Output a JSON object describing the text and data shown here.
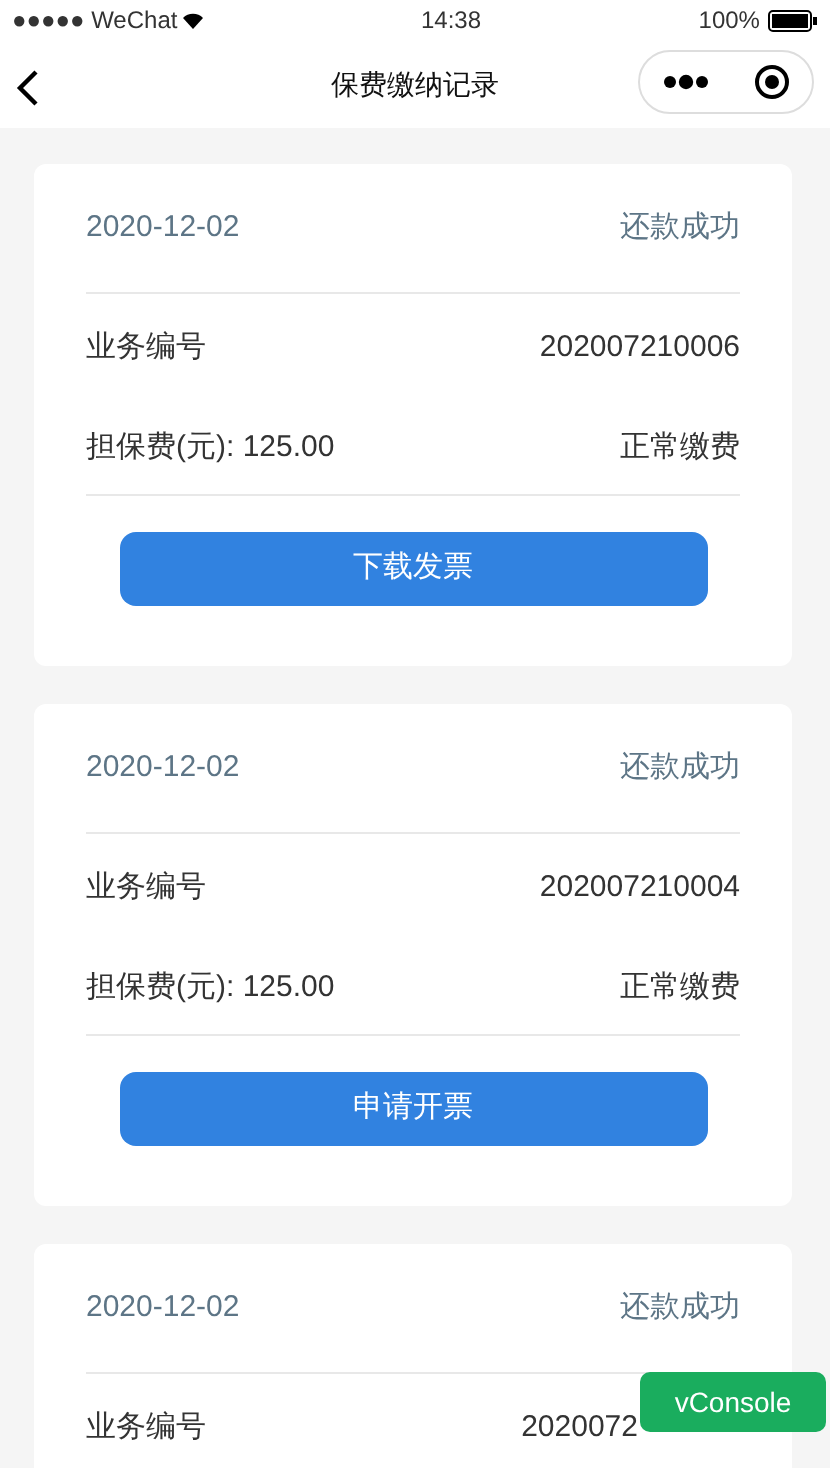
{
  "status_bar": {
    "carrier": "●●●●● WeChat",
    "time": "14:38",
    "battery": "100%"
  },
  "nav": {
    "title": "保费缴纳记录"
  },
  "records": [
    {
      "date": "2020-12-02",
      "status": "还款成功",
      "id_label": "业务编号",
      "id": "202007210006",
      "fee": "担保费(元): 125.00",
      "fee_type": "正常缴费",
      "button": "下载发票"
    },
    {
      "date": "2020-12-02",
      "status": "还款成功",
      "id_label": "业务编号",
      "id": "202007210004",
      "fee": "担保费(元): 125.00",
      "fee_type": "正常缴费",
      "button": "申请开票"
    },
    {
      "date": "2020-12-02",
      "status": "还款成功",
      "id_label": "业务编号",
      "id": "2020072"
    }
  ],
  "vconsole": "vConsole"
}
